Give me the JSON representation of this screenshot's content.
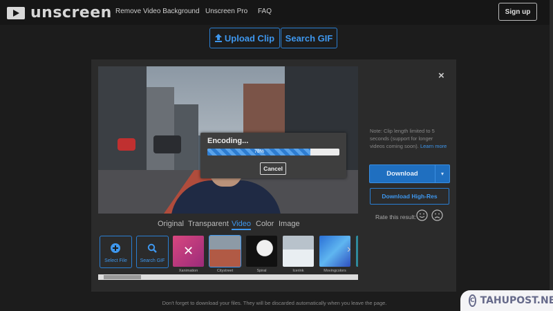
{
  "nav": {
    "brand": "unscreen",
    "links": [
      "Remove Video Background",
      "Unscreen Pro",
      "FAQ"
    ],
    "signup": "Sign up"
  },
  "actions": {
    "upload": "Upload Clip",
    "search_gif": "Search GIF"
  },
  "encoding": {
    "title": "Encoding...",
    "percent_label": "78%",
    "progress": 0.78,
    "cancel": "Cancel"
  },
  "tabs": [
    "Original",
    "Transparent",
    "Video",
    "Color",
    "Image"
  ],
  "active_tab": "Video",
  "strip": {
    "select_file": "Select File",
    "search_gif": "Search GIF",
    "thumbs": [
      "Xanimation",
      "Citystreet",
      "Spiral",
      "Icerink",
      "Movingcolors"
    ],
    "selected": "Citystreet"
  },
  "sidebar": {
    "close": "×",
    "note": "Note: Clip length limited to 5 seconds (support for longer videos coming soon).",
    "learn_more": "Learn more",
    "download": "Download",
    "download_hires": "Download High-Res",
    "rate": "Rate this result:"
  },
  "footer_note": "Don't forget to download your files. They will be discarded automatically when you leave the page.",
  "watermark": "TAHUPOST.NET",
  "colors": {
    "accent": "#2a7fd4",
    "background": "#1c1c1c",
    "panel": "#2b2b2b"
  }
}
